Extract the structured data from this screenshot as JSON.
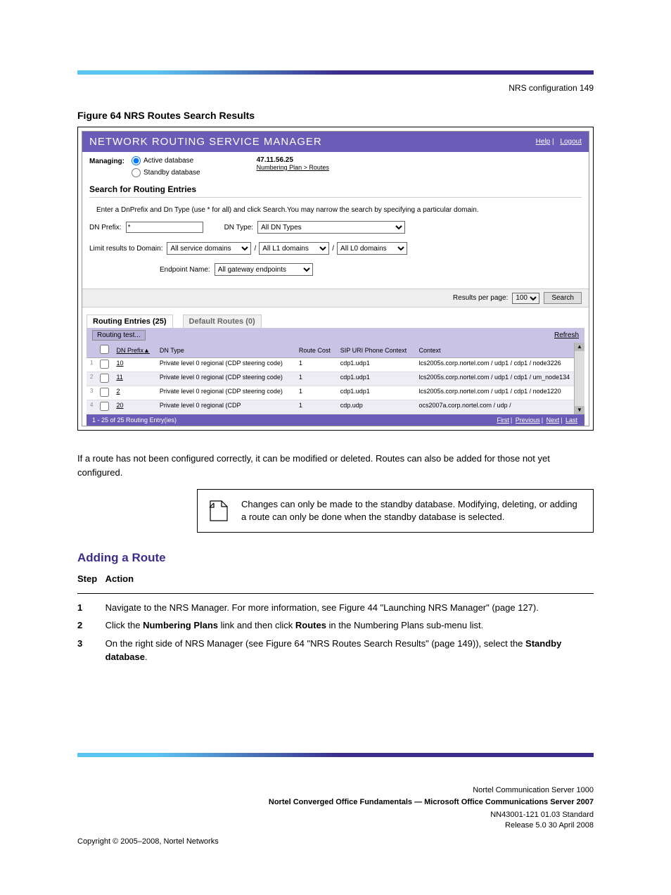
{
  "doc_header_right": "NRS configuration  149",
  "figure_title": "Figure 64 NRS Routes Search Results",
  "screenshot": {
    "header_title": "NETWORK ROUTING SERVICE MANAGER",
    "help": "Help",
    "logout": "Logout",
    "managing_label": "Managing:",
    "radio_active": "Active database",
    "radio_standby": "Standby database",
    "ip": "47.11.56.25",
    "breadcrumb": "Numbering Plan > Routes",
    "section_title": "Search for Routing Entries",
    "instruction": "Enter a DnPrefix and Dn Type (use * for all) and click Search.You may narrow the search by specifying a particular domain.",
    "dn_prefix_label": "DN Prefix:",
    "dn_prefix_value": "*",
    "dn_type_label": "DN Type:",
    "dn_type_value": "All DN Types",
    "limit_label": "Limit results to Domain:",
    "limit_value": "All service domains",
    "l1_value": "All L1 domains",
    "l0_value": "All L0 domains",
    "endpoint_label": "Endpoint Name:",
    "endpoint_value": "All gateway endpoints",
    "results_per_page_label": "Results per page:",
    "results_per_page_value": "100",
    "search_button": "Search",
    "tab_active": "Routing Entries (25)",
    "tab_inactive": "Default Routes (0)",
    "routing_test_btn": "Routing test...",
    "refresh": "Refresh",
    "columns": {
      "dn_prefix": "DN Prefix",
      "dn_type": "DN Type",
      "route_cost": "Route Cost",
      "sip_uri": "SIP URI Phone Context",
      "context": "Context"
    },
    "rows": [
      {
        "idx": "1",
        "prefix": "10",
        "type": "Private level 0 regional (CDP steering code)",
        "cost": "1",
        "sip": "cdp1.udp1",
        "ctx": "lcs2005s.corp.nortel.com / udp1 / cdp1 / node3226"
      },
      {
        "idx": "2",
        "prefix": "11",
        "type": "Private level 0 regional (CDP steering code)",
        "cost": "1",
        "sip": "cdp1.udp1",
        "ctx": "lcs2005s.corp.nortel.com / udp1 / cdp1 / um_node134"
      },
      {
        "idx": "3",
        "prefix": "2",
        "type": "Private level 0 regional (CDP steering code)",
        "cost": "1",
        "sip": "cdp1.udp1",
        "ctx": "lcs2005s.corp.nortel.com / udp1 / cdp1 / node1220"
      },
      {
        "idx": "4",
        "prefix": "20",
        "type": "Private level 0 regional (CDP",
        "cost": "1",
        "sip": "cdp.udp",
        "ctx": "ocs2007a.corp.nortel.com / udp /"
      }
    ],
    "status_text": "1 - 25 of 25 Routing Entry(ies)",
    "pager": {
      "first": "First",
      "prev": "Previous",
      "next": "Next",
      "last": "Last"
    }
  },
  "body_text_1": "If a route has not been configured correctly, it can be modified or deleted. Routes can also be added for those not yet configured.",
  "note_text": "Changes can only be made to the standby database. Modifying, deleting, or adding a route can only be done when the standby database is selected.",
  "section_head": "Adding a Route",
  "steps": {
    "s1_num": "Step",
    "s1_txt_a": "Action",
    "s1": "1",
    "s1_txt": "Navigate to the NRS Manager. For more information, see Figure 44 \"Launching NRS Manager\" (page 127).",
    "s2": "2",
    "s2_txt_a": "Click the ",
    "s2_nav": "Numbering Plans",
    "s2_txt_b": " link and then click ",
    "s2_nav2": "Routes",
    "s2_txt_c": " in the Numbering Plans sub-menu list.",
    "s3": "3",
    "s3_txt_a": "On the right side of NRS Manager (see Figure 64 \"NRS Routes Search Results\" (page 149)), select the ",
    "s3_nav": "Standby database",
    "s3_txt_b": "."
  },
  "footer": {
    "line1": "Nortel Communication Server 1000",
    "line2": "Nortel Converged Office Fundamentals — Microsoft Office Communications Server 2007",
    "line3": "NN43001-121 01.03 Standard",
    "line4": "Release 5.0 30 April 2008"
  },
  "copyright": "Copyright © 2005–2008, Nortel Networks"
}
